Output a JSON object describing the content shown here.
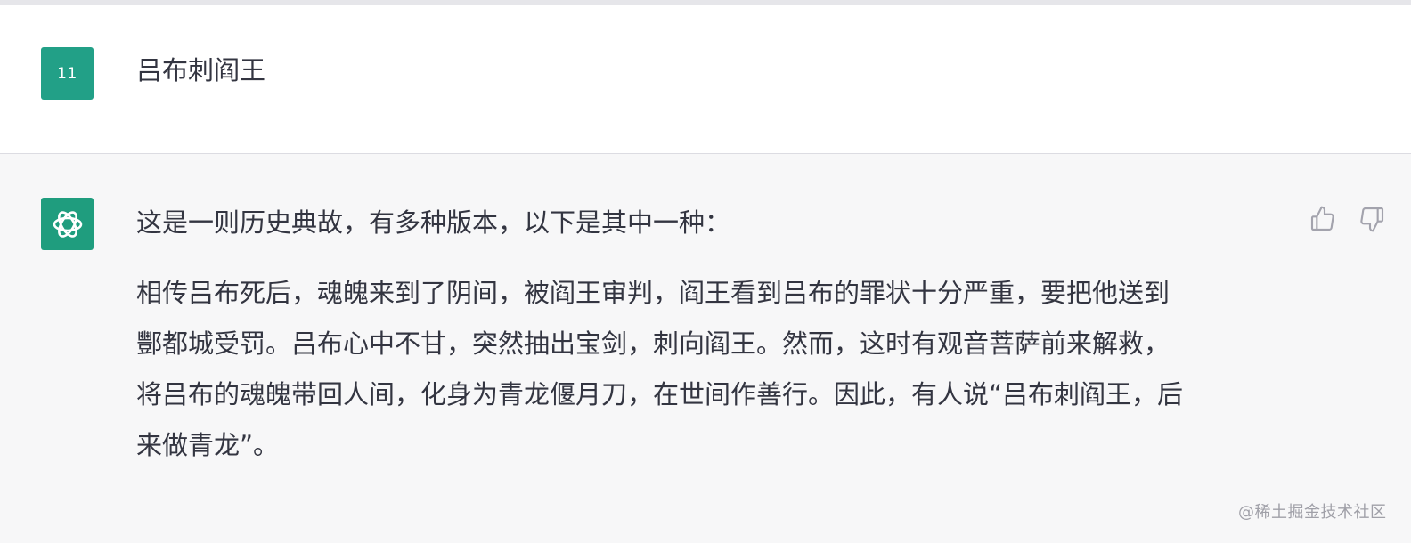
{
  "user": {
    "avatar_label": "11",
    "message": "吕布刺阎王"
  },
  "assistant": {
    "avatar_icon": "openai-logo-icon",
    "intro": "这是一则历史典故，有多种版本，以下是其中一种：",
    "story_lines": [
      "相传吕布死后，魂魄来到了阴间，被阎王审判，阎王看到吕布的罪状十分严重，要把他送到",
      "酆都城受罚。吕布心中不甘，突然抽出宝剑，刺向阎王。然而，这时有观音菩萨前来解救，",
      "将吕布的魂魄带回人间，化身为青龙偃月刀，在世间作善行。因此，有人说“吕布刺阎王，后",
      "来做青龙”。"
    ],
    "feedback": {
      "up_icon": "thumbs-up-icon",
      "down_icon": "thumbs-down-icon"
    }
  },
  "watermark": "@稀土掘金技术社区",
  "colors": {
    "user_avatar_bg": "#22a087",
    "assistant_avatar_bg": "#1f9d7e",
    "assistant_row_bg": "#f7f7f8",
    "text": "#333541"
  }
}
